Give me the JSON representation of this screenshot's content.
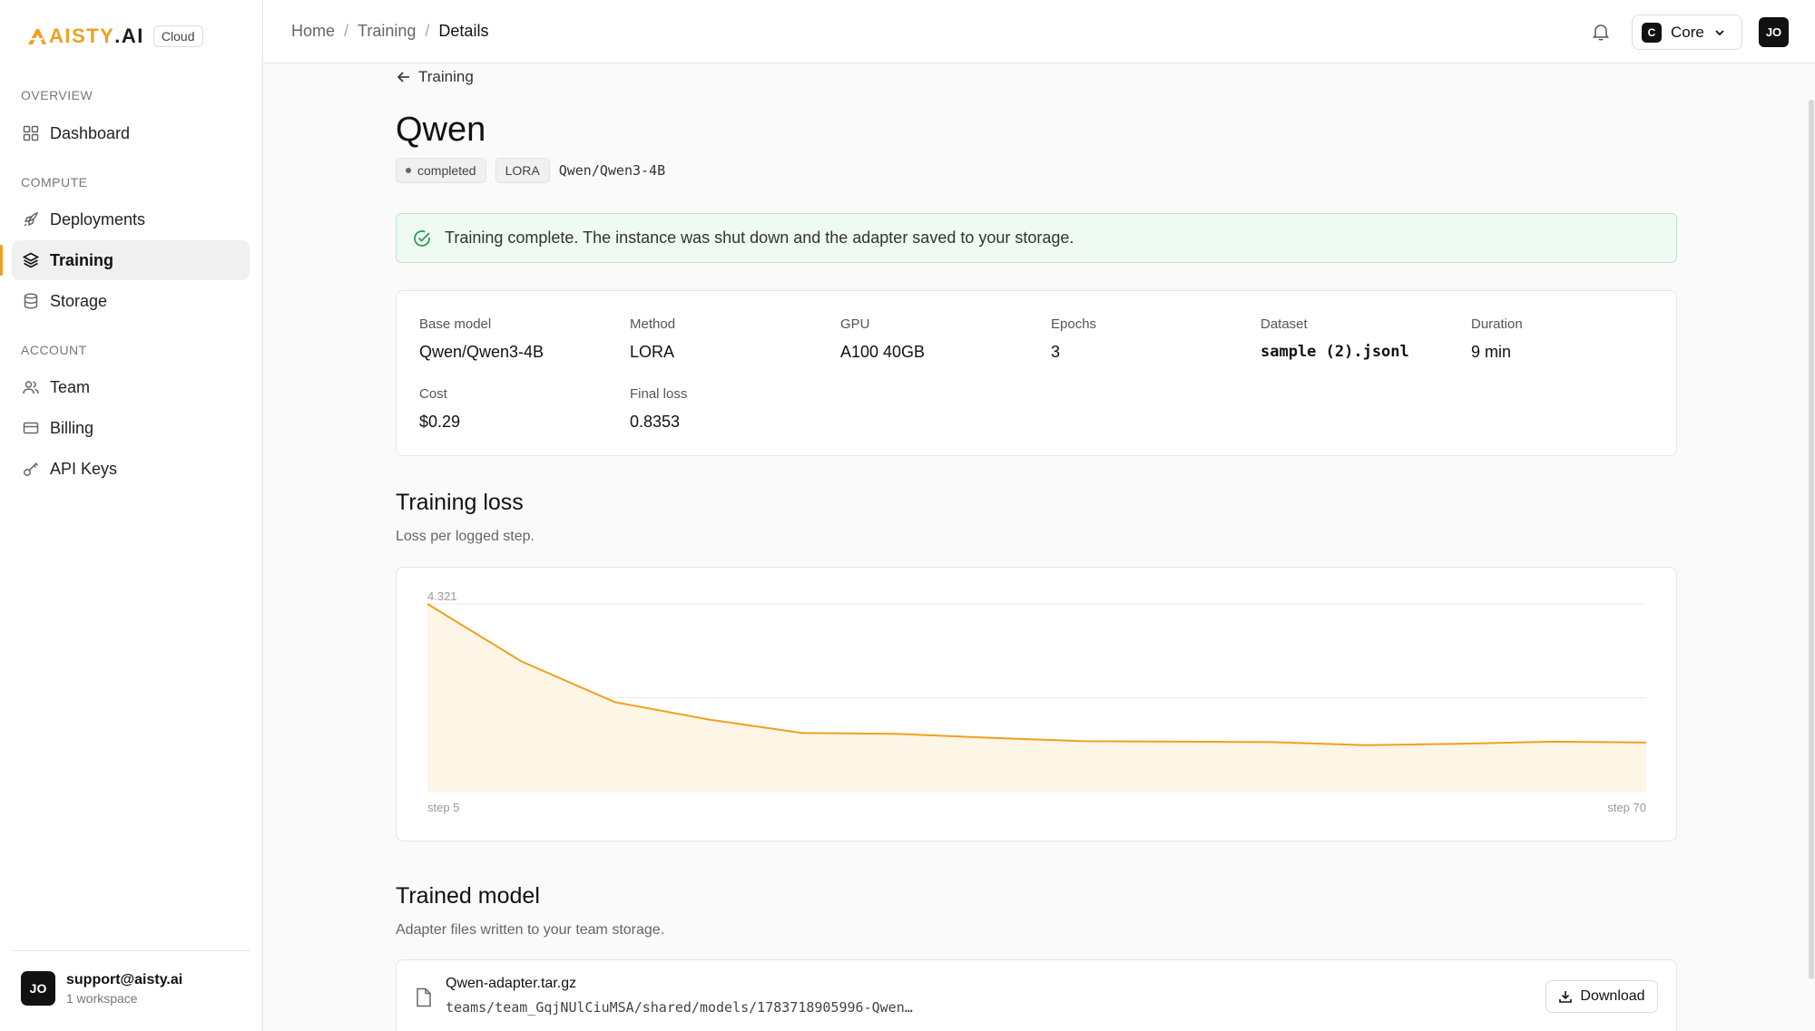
{
  "brand": {
    "logo_text_a": "AISTY",
    "logo_text_b": ".AI",
    "badge": "Cloud"
  },
  "sidebar": {
    "sections": [
      {
        "label": "OVERVIEW"
      },
      {
        "label": "COMPUTE"
      },
      {
        "label": "ACCOUNT"
      }
    ],
    "items": [
      {
        "label": "Dashboard",
        "icon": "grid-icon"
      },
      {
        "label": "Deployments",
        "icon": "rocket-icon"
      },
      {
        "label": "Training",
        "icon": "layers-icon",
        "active": true
      },
      {
        "label": "Storage",
        "icon": "database-icon"
      },
      {
        "label": "Team",
        "icon": "users-icon"
      },
      {
        "label": "Billing",
        "icon": "credit-card-icon"
      },
      {
        "label": "API Keys",
        "icon": "key-icon"
      }
    ],
    "user": {
      "initials": "JO",
      "email": "support@aisty.ai",
      "sub": "1 workspace"
    }
  },
  "header": {
    "breadcrumb": [
      "Home",
      "Training",
      "Details"
    ],
    "workspace": {
      "initial": "C",
      "name": "Core"
    },
    "avatar": "JO"
  },
  "page": {
    "back_label": "Training",
    "title": "Qwen",
    "tags": {
      "status": "completed",
      "method": "LORA",
      "model": "Qwen/Qwen3-4B"
    },
    "alert": "Training complete. The instance was shut down and the adapter saved to your storage.",
    "stats": [
      {
        "label": "Base model",
        "value": "Qwen/Qwen3-4B"
      },
      {
        "label": "Method",
        "value": "LORA"
      },
      {
        "label": "GPU",
        "value": "A100 40GB"
      },
      {
        "label": "Epochs",
        "value": "3"
      },
      {
        "label": "Dataset",
        "value": "sample (2).jsonl"
      },
      {
        "label": "Duration",
        "value": "9 min"
      },
      {
        "label": "Cost",
        "value": "$0.29"
      },
      {
        "label": "Final loss",
        "value": "0.8353"
      }
    ],
    "loss_section": {
      "title": "Training loss",
      "subtitle": "Loss per logged step."
    },
    "model_section": {
      "title": "Trained model",
      "subtitle": "Adapter files written to your team storage."
    },
    "file": {
      "name": "Qwen-adapter.tar.gz",
      "path": "teams/team_GqjNUlCiuMSA/shared/models/1783718905996-Qwen…",
      "download_label": "Download"
    }
  },
  "colors": {
    "accent": "#f0a020",
    "success": "#2a9d5c"
  },
  "chart_data": {
    "type": "area",
    "title": "",
    "x": [
      5,
      10,
      15,
      20,
      25,
      30,
      35,
      40,
      45,
      50,
      55,
      60,
      65,
      70
    ],
    "series": [
      {
        "values": [
          4.321,
          3.0,
          2.06,
          1.66,
          1.35,
          1.33,
          1.24,
          1.16,
          1.15,
          1.14,
          1.07,
          1.1,
          1.15,
          1.13
        ]
      }
    ],
    "ylim": [
      0,
      4.321
    ],
    "y_tick_label": "4.321",
    "x_start_label": "step 5",
    "x_end_label": "step 70",
    "grid": true
  }
}
